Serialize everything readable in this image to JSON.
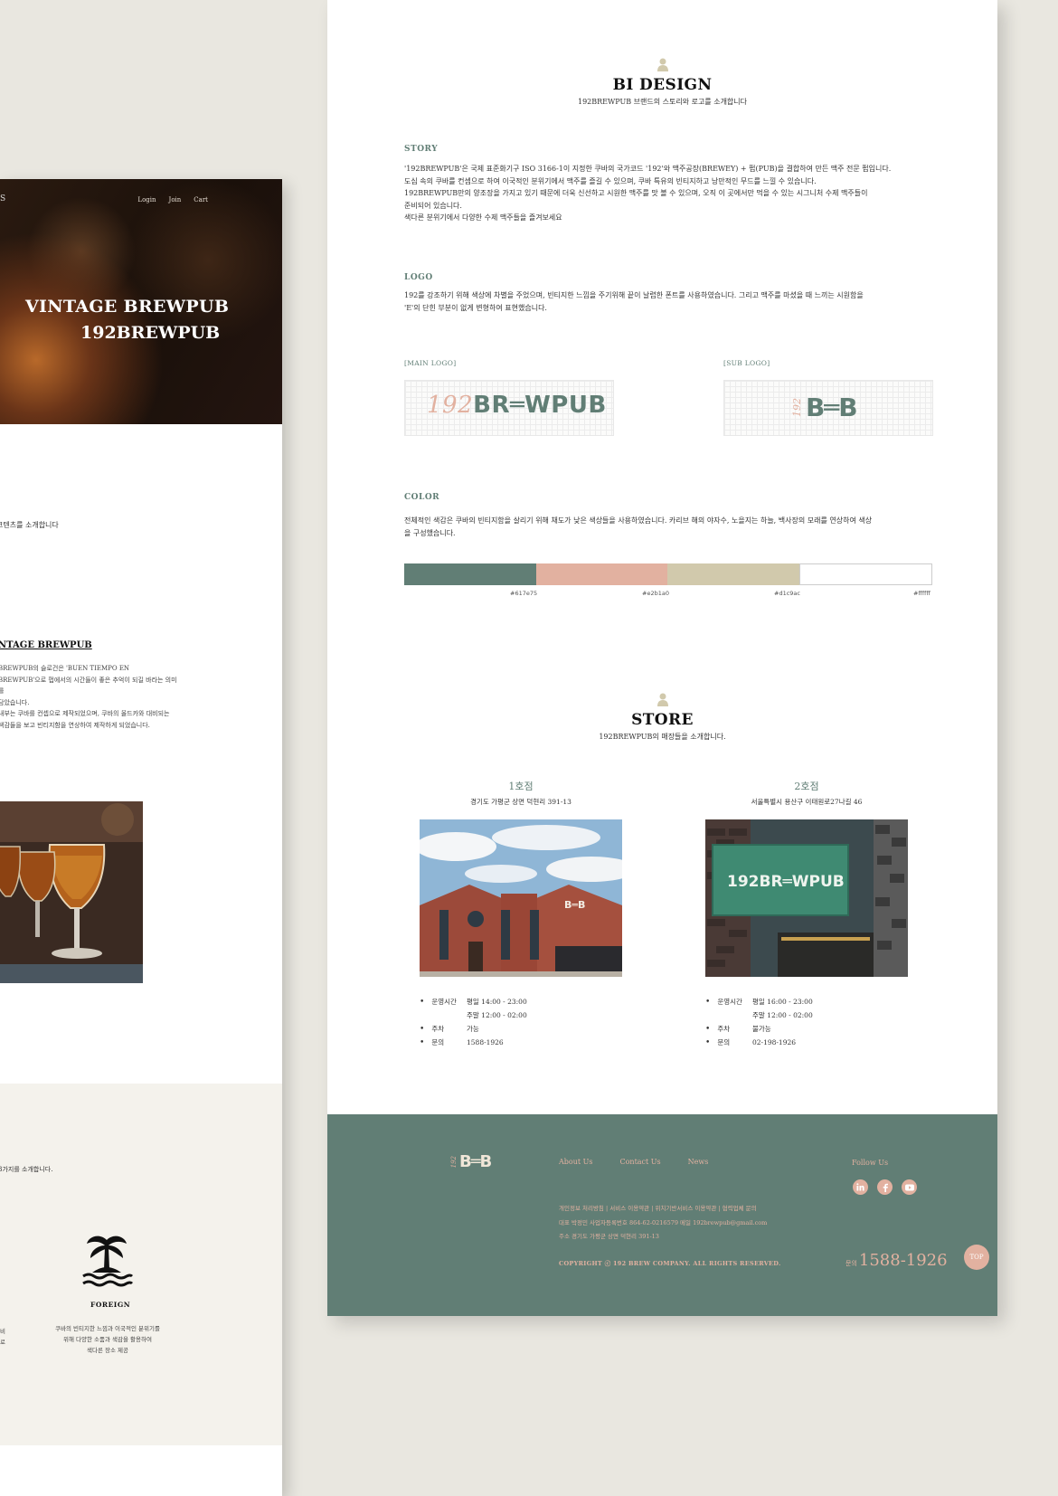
{
  "colors": {
    "accent_green": "#617e75",
    "accent_pink": "#e2b1a0",
    "accent_sand": "#d1c9ac",
    "white": "#ffffff"
  },
  "left_page": {
    "logo_fragment": "S",
    "nav": [
      "Login",
      "Join",
      "Cart"
    ],
    "hero_line1": "VINTAGE BREWPUB",
    "hero_line2": "192BREWPUB",
    "intro_fragment": "코텐츠를 소개합니다",
    "vintage_heading": "NTAGE BREWPUB",
    "vintage_para": "BREWPUB의 슬로건은 'BUEN TIEMPO EN\nBREWPUB'으로 펍에서의 시간들이 좋은 추억이 되길 바라는 의미를\n담았습니다.\n내부는 쿠바를 컨셉으로 제작되었으며, 쿠바의 올드카와 대비되는\n색감들을 보고 빈티지함을 연상하여 제작하게 되었습니다.",
    "three_fragment": "3가지를 소개합니다.",
    "foreign_label": "FOREIGN",
    "foreign_text": "쿠바의 빈티지한 느낌과 이국적인 분위기를\n위해 다양한 소품과 색감을 활용하여\n색다른 장소 제공",
    "frag_a": "비",
    "frag_b": "로"
  },
  "bi_design": {
    "title": "BI DESIGN",
    "subtitle": "192BREWPUB 브랜드의 스토리와 로고를 소개합니다",
    "story_label": "STORY",
    "story_text": "'192BREWPUB'은 국제 표준화기구 ISO 3166-1이 지정한 쿠바의 국가코드 '192'와 맥주공장(BREWEY) + 펍(PUB)을 결합하여 만든 맥주 전문 펍입니다.\n도심 속의 쿠바를 컨셉으로 하여 이국적인 분위기에서 맥주를 즐길 수 있으며, 쿠바 특유의 빈티지하고 낭만적인 무드를 느낄 수 있습니다.\n192BREWPUB만의 양조장을 가지고 있기 때문에 더욱 신선하고 시원한 맥주를 맛 볼 수 있으며, 오직 이 곳에서만 먹을 수 있는 시그니처 수제 맥주들이\n준비되어 있습니다.\n색다른 분위기에서 다양한 수제 맥주들을 즐겨보세요",
    "logo_label": "LOGO",
    "logo_text": "192를 강조하기 위해 색상에 차별을 주었으며, 빈티지한 느낌을 주기위해 끝이 날렵한 폰트를 사용하였습니다. 그리고 맥주를 마셨을 때 느끼는 시원함을\n'E'의 단힌 부분이 없게 변형하여 표현했습니다.",
    "main_logo_caption": "[MAIN LOGO]",
    "sub_logo_caption": "[SUB LOGO]",
    "logo_num": "192",
    "logo_word": "BR═WPUB",
    "sub_logo_word": "B═B",
    "color_label": "COLOR",
    "color_text": "전체적인 색감은 쿠바의 빈티지함을 살리기 위해 채도가 낮은 색상들을 사용하였습니다. 카리브 해의 야자수, 노을지는 하늘, 백사장의 모래를 연상하여 색상\n을 구성했습니다.",
    "swatches": [
      {
        "hex": "#617e75",
        "label": "#617e75"
      },
      {
        "hex": "#e2b1a0",
        "label": "#e2b1a0"
      },
      {
        "hex": "#d1c9ac",
        "label": "#d1c9ac"
      },
      {
        "hex": "#ffffff",
        "label": "#ffffff"
      }
    ]
  },
  "store": {
    "title": "STORE",
    "subtitle": "192BREWPUB의 매장들을 소개합니다.",
    "stores": [
      {
        "name": "1호점",
        "address": "경기도 가평군 상면 덕현리 391-13",
        "hours_label": "운영시간",
        "hours_weekday": "평일 14:00 - 23:00",
        "hours_weekend": "주말 12:00 - 02:00",
        "parking_label": "주차",
        "parking": "가능",
        "contact_label": "문의",
        "contact": "1588-1926"
      },
      {
        "name": "2호점",
        "address": "서울특별시 용산구 이태원로27나길 46",
        "hours_label": "운영시간",
        "hours_weekday": "평일 16:00 - 23:00",
        "hours_weekend": "주말 12:00 - 02:00",
        "parking_label": "주차",
        "parking": "불가능",
        "contact_label": "문의",
        "contact": "02-198-1926"
      }
    ],
    "sign_text": "192BR═WPUB",
    "building_sign": "B═B"
  },
  "footer": {
    "logo_num": "192",
    "logo_word": "B═B",
    "nav": [
      "About Us",
      "Contact Us",
      "News"
    ],
    "follow_label": "Follow Us",
    "social_icons": [
      "linkedin-icon",
      "facebook-icon",
      "youtube-icon"
    ],
    "links_text": "개인정보 처리방침 | 서비스 이용약관 | 위치기반서비스 이용약관 | 협력업체 문의\n대표 박정민   사업자등록번호 864-62-0216579 메일 192brewpub@gmail.com\n주소  경기도 가평군 상면 덕현리 391-13",
    "copyright": "COPYRIGHT ⓒ 192 BREW COMPANY. ALL RIGHTS RESERVED.",
    "phone_label": "문의",
    "phone": "1588-1926",
    "top_button": "TOP"
  }
}
